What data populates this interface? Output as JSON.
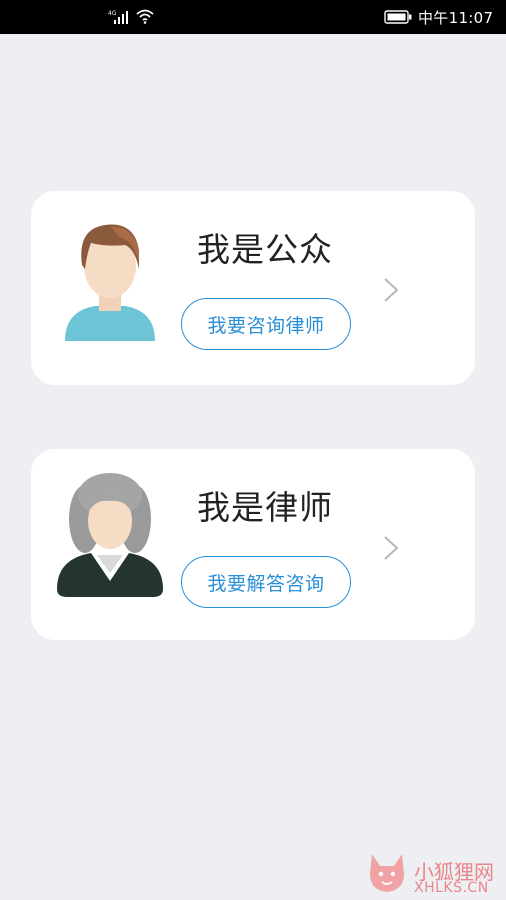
{
  "status_bar": {
    "time": "中午11:07"
  },
  "cards": [
    {
      "title": "我是公众",
      "button_label": "我要咨询律师",
      "avatar_icon": "man-avatar-icon"
    },
    {
      "title": "我是律师",
      "button_label": "我要解答咨询",
      "avatar_icon": "judge-avatar-icon"
    }
  ],
  "colors": {
    "accent": "#2b8fd6",
    "background": "#eeeff3",
    "card": "#ffffff",
    "watermark": "#e9868b"
  },
  "watermark": {
    "text": "小狐狸网",
    "sub": "XHLKS.CN"
  }
}
